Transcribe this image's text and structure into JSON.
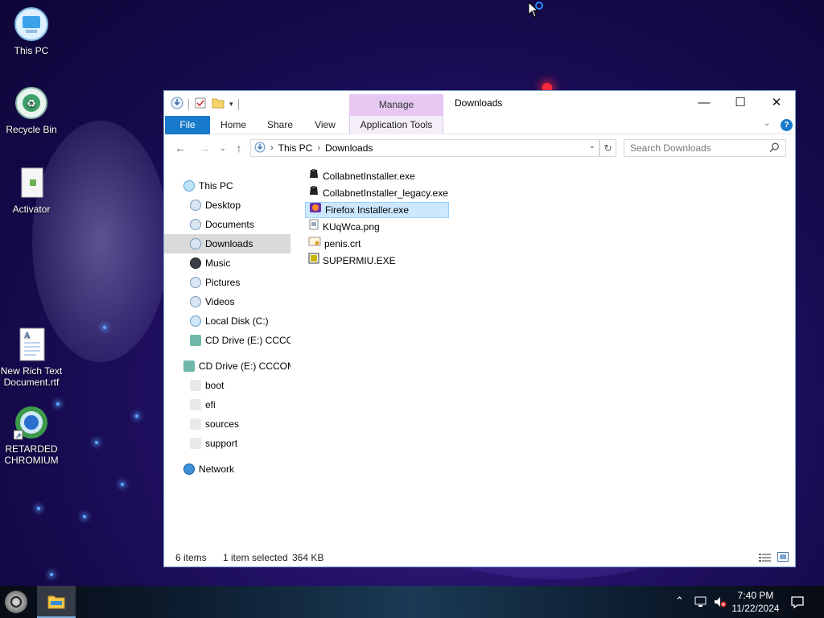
{
  "desktop": {
    "icons": [
      {
        "label": "This PC"
      },
      {
        "label": "Recycle Bin"
      },
      {
        "label": "Activator"
      },
      {
        "label": "New Rich Text Document.rtf"
      },
      {
        "label": "RETARDED CHROMIUM"
      }
    ]
  },
  "window": {
    "title": "Downloads",
    "context_tab": "Manage",
    "ribbon_tabs": [
      "File",
      "Home",
      "Share",
      "View",
      "Application Tools"
    ],
    "controls": {
      "minimize": "—",
      "maximize": "☐",
      "close": "✕"
    },
    "address": {
      "crumbs": [
        "This PC",
        "Downloads"
      ]
    },
    "search": {
      "placeholder": "Search Downloads"
    },
    "nav_pane": [
      {
        "label": "This PC",
        "icon": "this-pc-icon"
      },
      {
        "label": "Desktop",
        "icon": "desktop-icon"
      },
      {
        "label": "Documents",
        "icon": "documents-icon"
      },
      {
        "label": "Downloads",
        "icon": "downloads-icon",
        "selected": true
      },
      {
        "label": "Music",
        "icon": "music-icon"
      },
      {
        "label": "Pictures",
        "icon": "pictures-icon"
      },
      {
        "label": "Videos",
        "icon": "videos-icon"
      },
      {
        "label": "Local Disk (C:)",
        "icon": "local-disk-icon"
      },
      {
        "label": "CD Drive (E:) CCCO",
        "icon": "cd-drive-icon"
      },
      {
        "label": "CD Drive (E:) CCCOM",
        "icon": "cd-drive-icon"
      },
      {
        "label": "boot",
        "icon": "folder-icon"
      },
      {
        "label": "efi",
        "icon": "folder-icon"
      },
      {
        "label": "sources",
        "icon": "folder-icon"
      },
      {
        "label": "support",
        "icon": "folder-icon"
      },
      {
        "label": "Network",
        "icon": "network-icon"
      }
    ],
    "files": [
      {
        "name": "CollabnetInstaller.exe",
        "icon": "exe-icon"
      },
      {
        "name": "CollabnetInstaller_legacy.exe",
        "icon": "exe-icon"
      },
      {
        "name": "Firefox Installer.exe",
        "icon": "firefox-icon",
        "selected": true
      },
      {
        "name": "KUqWca.png",
        "icon": "png-file-icon"
      },
      {
        "name": "penis.crt",
        "icon": "certificate-icon"
      },
      {
        "name": "SUPERMIU.EXE",
        "icon": "exe-icon"
      }
    ],
    "status": {
      "item_count": "6 items",
      "selection": "1 item selected",
      "size": "364 KB"
    }
  },
  "taskbar": {
    "time": "7:40 PM",
    "date": "11/22/2024"
  }
}
